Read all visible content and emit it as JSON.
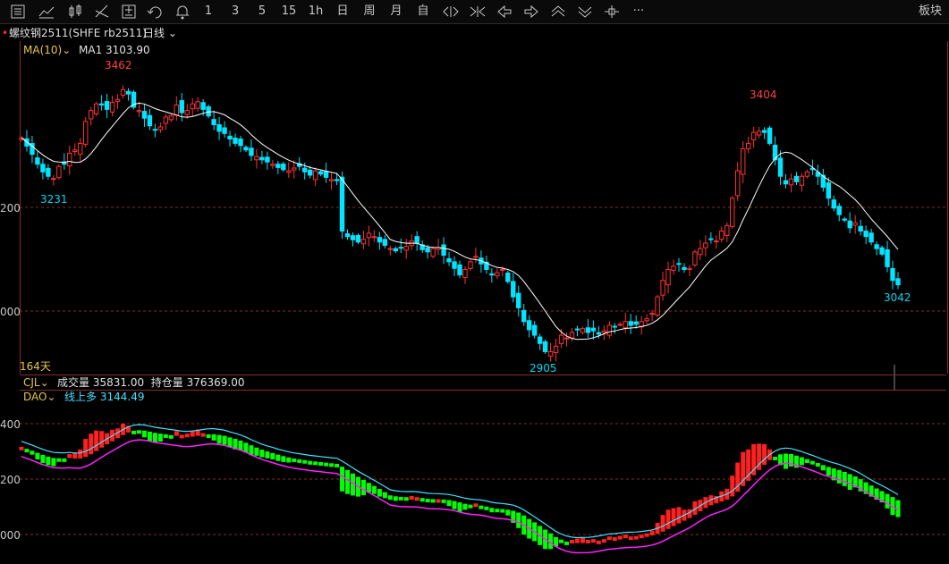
{
  "toolbar": {
    "icons": [
      "list-icon",
      "line-chart-icon",
      "kline-icon",
      "draw-icon",
      "calc-icon",
      "refresh-icon",
      "bell-icon"
    ],
    "periods": [
      "1",
      "3",
      "5",
      "15",
      "1h",
      "日",
      "周",
      "月",
      "自"
    ],
    "nav_icons": [
      "fit-icon",
      "shrink-icon",
      "back-icon",
      "forward-icon",
      "up-icon",
      "down-icon",
      "crosshair-icon",
      "more-icon"
    ],
    "more": "···",
    "right_label": "板块"
  },
  "header": {
    "instrument": "螺纹钢2511(SHFE rb2511)",
    "period_select": "日线"
  },
  "main_chart": {
    "indicator": "MA(10)",
    "ma_label": "MA1",
    "ma_value": "3103.90",
    "days_label": "164天",
    "high_labels": [
      "3462",
      "3404"
    ],
    "low_labels": [
      "3231",
      "2905",
      "3042"
    ]
  },
  "volume_bar": {
    "indicator": "CJL",
    "vol_label": "成交量",
    "vol_value": "35831.00",
    "oi_label": "持仓量",
    "oi_value": "376369.00"
  },
  "dao_chart": {
    "indicator": "DAO",
    "line_label": "线上多",
    "line_value": "3144.49"
  },
  "colors": {
    "up": "#ff3030",
    "down": "#00e4ff",
    "ma": "#ffffff",
    "dao_up": "#ff2020",
    "dao_down": "#00ff00",
    "dao_line": "#40e0ff",
    "dao_line2": "#ff20ff",
    "grid": "#8a2a2a",
    "yellow": "#e6c64a"
  },
  "chart_data": {
    "type": "candlestick",
    "y_ticks_main": [
      "200",
      "000"
    ],
    "y_ticks_dao": [
      "400",
      "200",
      "000"
    ],
    "ylim_main": [
      2880,
      3480
    ],
    "close": [
      3310,
      3295,
      3280,
      3262,
      3248,
      3240,
      3236,
      3258,
      3262,
      3282,
      3288,
      3300,
      3340,
      3360,
      3372,
      3370,
      3362,
      3375,
      3380,
      3398,
      3390,
      3366,
      3360,
      3346,
      3332,
      3325,
      3330,
      3348,
      3350,
      3370,
      3356,
      3360,
      3372,
      3376,
      3362,
      3350,
      3334,
      3322,
      3318,
      3308,
      3300,
      3296,
      3288,
      3278,
      3276,
      3270,
      3266,
      3262,
      3256,
      3252,
      3250,
      3255,
      3258,
      3248,
      3242,
      3250,
      3244,
      3238,
      3234,
      3232,
      3140,
      3130,
      3124,
      3120,
      3125,
      3136,
      3130,
      3120,
      3114,
      3108,
      3104,
      3110,
      3112,
      3122,
      3118,
      3106,
      3102,
      3108,
      3110,
      3096,
      3084,
      3072,
      3060,
      3070,
      3084,
      3094,
      3080,
      3070,
      3060,
      3064,
      3070,
      3048,
      3020,
      3000,
      2975,
      2960,
      2950,
      2935,
      2920,
      2920,
      2930,
      2950,
      2945,
      2955,
      2960,
      2962,
      2955,
      2958,
      2952,
      2958,
      2968,
      2965,
      2970,
      2975,
      2968,
      2970,
      2975,
      2980,
      2990,
      3020,
      3050,
      3070,
      3076,
      3080,
      3070,
      3072,
      3102,
      3108,
      3118,
      3125,
      3122,
      3140,
      3150,
      3200,
      3250,
      3290,
      3300,
      3320,
      3322,
      3320,
      3300,
      3270,
      3240,
      3226,
      3235,
      3230,
      3240,
      3248,
      3252,
      3240,
      3220,
      3200,
      3182,
      3170,
      3160,
      3146,
      3155,
      3140,
      3130,
      3120,
      3108,
      3098,
      3075,
      3050,
      3042
    ],
    "ma_note": "MA(10) line over close series"
  }
}
